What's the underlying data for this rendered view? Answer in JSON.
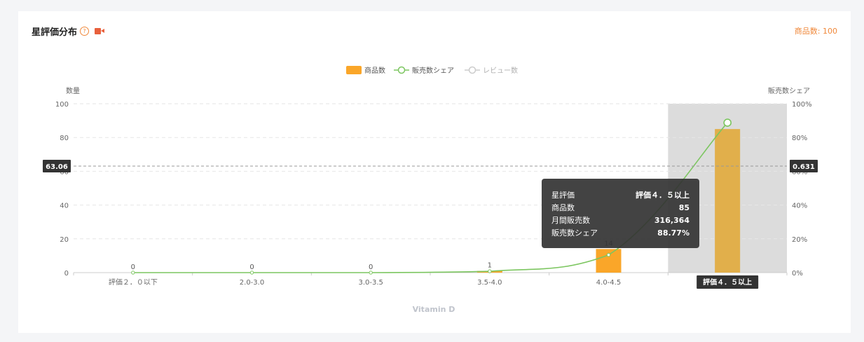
{
  "header": {
    "title": "星評価分布",
    "help_icon": "question-circle-icon",
    "video_icon": "video-camera-icon",
    "product_count": "商品数: 100"
  },
  "colors": {
    "bar": "#faa629",
    "bar_highlight": "#e1af4b",
    "line": "#7cc660",
    "highlight_band": "#dcdcdc",
    "accent": "#f0883a"
  },
  "chart_data": {
    "type": "bar",
    "categories": [
      "評価２．０以下",
      "2.0-3.0",
      "3.0-3.5",
      "3.5-4.0",
      "4.0-4.5",
      "評価４．５以上"
    ],
    "series": [
      {
        "name": "商品数",
        "type": "bar",
        "axis": "left",
        "values": [
          0,
          0,
          0,
          1,
          14,
          85
        ],
        "labels": [
          "0",
          "0",
          "0",
          "1",
          "14",
          ""
        ]
      },
      {
        "name": "販売数シェア",
        "type": "line",
        "axis": "right",
        "values": [
          0,
          0,
          0,
          0.8,
          10.5,
          88.77
        ]
      },
      {
        "name": "レビュー数",
        "type": "line",
        "axis": "right",
        "disabled": true,
        "values": []
      }
    ],
    "y_left": {
      "label": "数量",
      "min": 0,
      "max": 100,
      "ticks": [
        "0",
        "20",
        "40",
        "60",
        "80",
        "100"
      ]
    },
    "y_right": {
      "label": "販売数シェア",
      "min": 0,
      "max": 100,
      "ticks": [
        "0%",
        "20%",
        "40%",
        "60%",
        "80%",
        "100%"
      ]
    },
    "xlabel": "Vitamin D",
    "grid": true,
    "legend_position": "top-center",
    "crosshair": {
      "left_value": 63.06,
      "left_label": "63.06",
      "right_label": "0.631",
      "category_label": "評価４．５以上",
      "category_index": 5
    },
    "tooltip": {
      "rows": [
        {
          "key": "星評価",
          "value": "評価４．５以上"
        },
        {
          "key": "商品数",
          "value": "85"
        },
        {
          "key": "月間販売数",
          "value": "316,364"
        },
        {
          "key": "販売数シェア",
          "value": "88.77%"
        }
      ]
    }
  }
}
